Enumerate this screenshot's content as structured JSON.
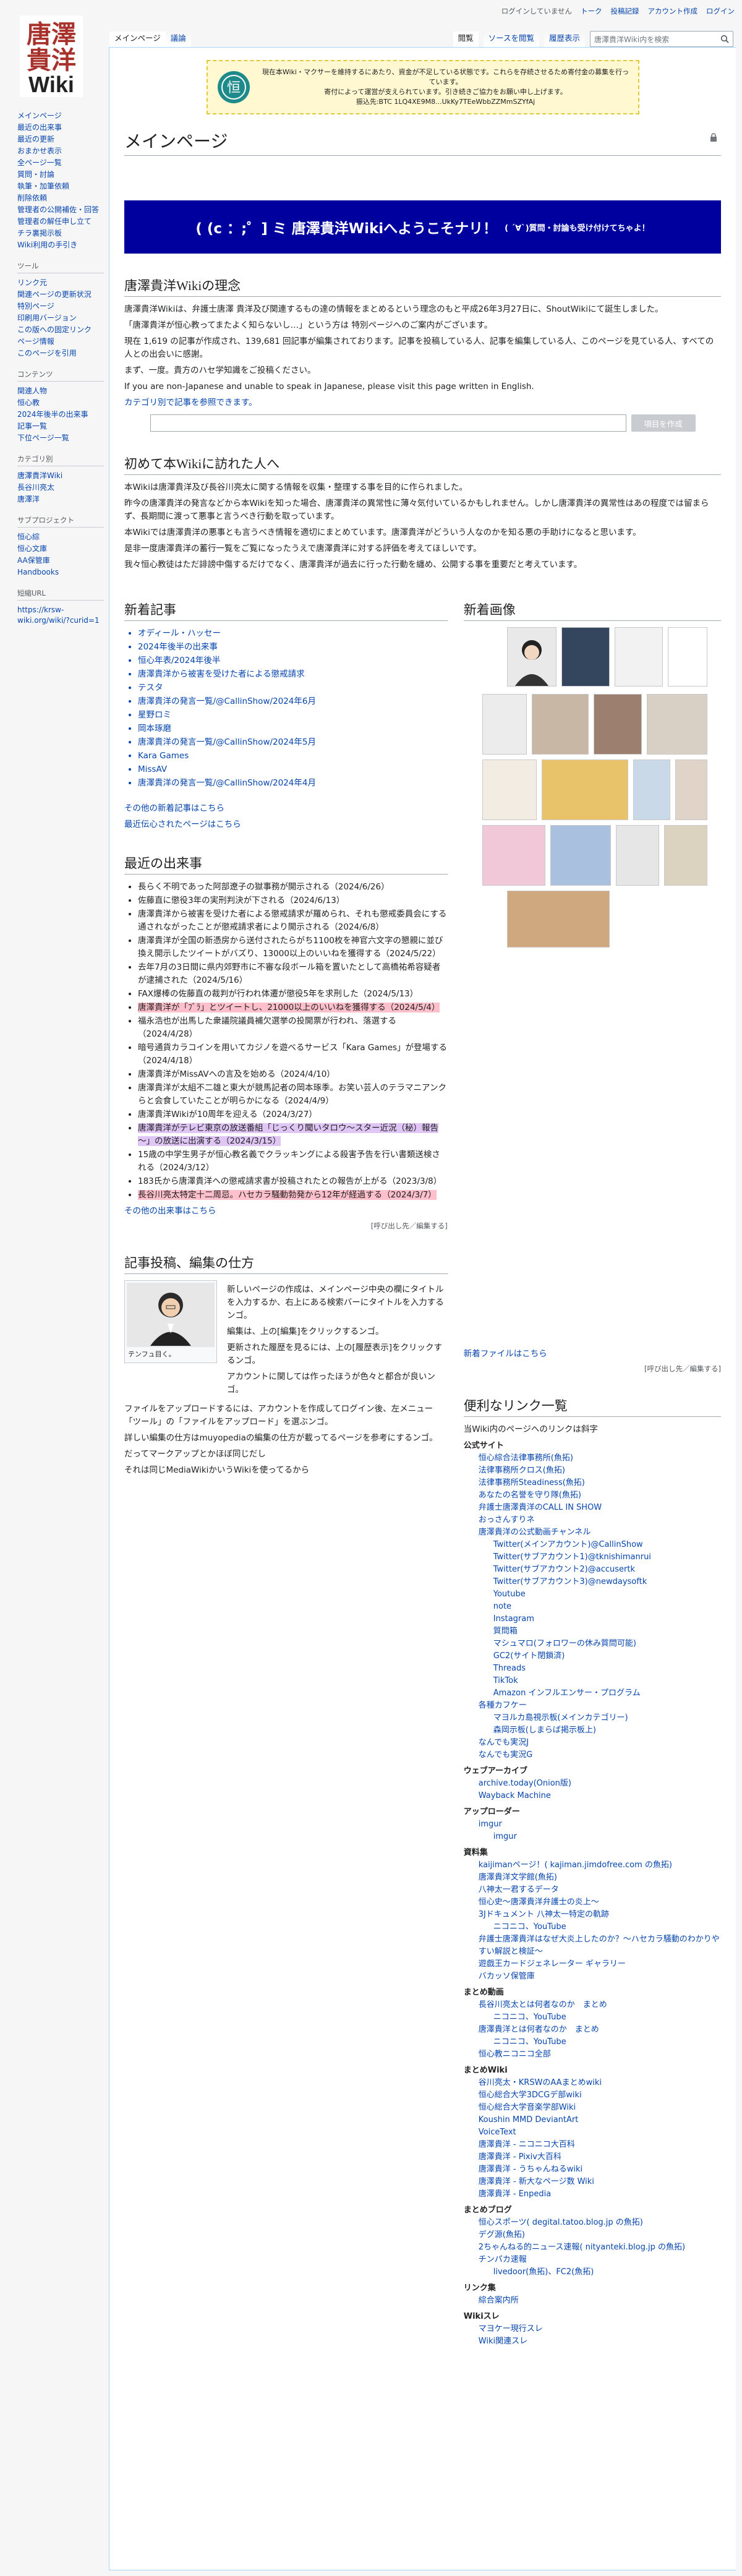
{
  "logo": {
    "line1": "唐澤",
    "line2": "貴洋",
    "line3": "Wiki"
  },
  "personal": [
    "ログインしていません",
    "トーク",
    "投稿記録",
    "アカウント作成",
    "ログイン"
  ],
  "tabs_left": [
    "メインページ",
    "議論"
  ],
  "tabs_right": [
    "閲覧",
    "ソースを閲覧",
    "履歴表示"
  ],
  "search": {
    "placeholder": "唐澤貴洋Wiki内を検索"
  },
  "sidebar": {
    "nav": [
      "メインページ",
      "最近の出来事",
      "最近の更新",
      "おまかせ表示",
      "全ページ一覧",
      "質問・討論",
      "執筆・加筆依頼",
      "削除依頼",
      "管理者の公開補佐・回答",
      "管理者の解任申し立て",
      "チラ裏掲示板",
      "Wiki利用の手引き"
    ],
    "tools_title": "ツール",
    "tools": [
      "リンク元",
      "関連ページの更新状況",
      "特別ページ",
      "印刷用バージョン",
      "この版への固定リンク",
      "ページ情報",
      "このページを引用"
    ],
    "content_title": "コンテンツ",
    "content": [
      "関連人物",
      "恒心教",
      "2024年後半の出来事",
      "記事一覧",
      "下位ページ一覧"
    ],
    "category_title": "カテゴリ別",
    "category": [
      "唐澤貴洋Wiki",
      "長谷川亮太",
      "唐澤洋"
    ],
    "sub_title": "サブプロジェクト",
    "sub": [
      "恒心綜",
      "恒心文庫",
      "AA保管庫",
      "Handbooks"
    ],
    "short_title": "短縮URL",
    "short": [
      "https://krsw-wiki.org/wiki/?curid=1"
    ]
  },
  "notice": {
    "line1": "現在本Wiki・マクサーを維持するにあたり、資金が不足している状態です。これらを存続させるため寄付金の募集を行っています。",
    "line2": "寄付によって運営が支えられています。引き続きご協力をお願い申し上げます。",
    "line3": "振込先:BTC 1LQ4XE9M8...UkKy7TEeWbbZZMmSZYfAj"
  },
  "page_title": "メインページ",
  "banner": {
    "big": "( (c ：;゜] ミ 唐澤貴洋Wikiへようこそナリ！",
    "small": "( ´∀`)質問・討論も受け付けてちゃよ！"
  },
  "rinen": {
    "h": "唐澤貴洋Wikiの理念",
    "p1": "唐澤貴洋Wikiは、弁護士唐澤 貴洋及び関連するもの達の情報をまとめるという理念のもと平成26年3月27日に、ShoutWikiにて誕生しました。",
    "p2": "「唐澤貴洋が恒心教ってまたよく知らないし…」という方は 特別ページへのご案内がございます。",
    "p3": "現在 1,619 の記事が作成され、139,681 回記事が編集されております。記事を投稿している人、記事を編集している人、このページを見ている人、すべての人との出会いに感謝。",
    "p4": "まず、一度。貴方のハセ学知識をご投稿ください。",
    "p5": "If you are non-Japanese and unable to speak in Japanese, please visit this page written in English.",
    "p6": "カテゴリ別で記事を参照できます。",
    "btn": "項目を作成"
  },
  "first": {
    "h": "初めて本Wikiに訪れた人へ",
    "p1": "本Wikiは唐澤貴洋及び長谷川亮太に関する情報を収集・整理する事を目的に作られました。",
    "p2": "昨今の唐澤貴洋の発言などから本Wikiを知った場合、唐澤貴洋の異常性に薄々気付いているかもしれません。しかし唐澤貴洋の異常性はあの程度では留まらず、長期間に渡って悪事と言うべき行動を取っています。",
    "p3": "本Wikiでは唐澤貴洋の悪事とも言うべき情報を適切にまとめています。唐澤貴洋がどういう人なのかを知る悪の手助けになると思います。",
    "p4": "是非一度唐澤貴洋の蓄行一覧をご覧になったうえで唐澤貴洋に対する評価を考えてほしいです。",
    "p5": "我々恒心教徒はただ誹謗中傷するだけでなく、唐澤貴洋が過去に行った行動を纏め、公開する事を重要だと考えています。"
  },
  "news": {
    "h": "新着記事",
    "items": [
      "オディール・ハッセー",
      "2024年後半の出来事",
      "恒心年表/2024年後半",
      "唐澤貴洋から被害を受けた者による懲戒請求",
      "テスタ",
      "唐澤貴洋の発言一覧/@CallinShow/2024年6月",
      "星野ロミ",
      "岡本琢磨",
      "唐澤貴洋の発言一覧/@CallinShow/2024年5月",
      "Kara Games",
      "MissAV",
      "唐澤貴洋の発言一覧/@CallinShow/2024年4月"
    ],
    "more1": "その他の新着記事はこちら",
    "more2": "最近伝心されたページはこちら"
  },
  "images": {
    "h": "新着画像",
    "more": "新着ファイルはこちら",
    "ctrl": "[呼び出し先／編集する]"
  },
  "events": {
    "h": "最近の出来事",
    "items": [
      {
        "t": "長らく不明であった阿部遼子の獄事務が開示される（2024/6/26）",
        "c": ""
      },
      {
        "t": "佐藤直に懲役3年の実刑判決が下される（2024/6/13）",
        "c": ""
      },
      {
        "t": "唐澤貴洋から被害を受けた者による懲戒請求が羅められ、それも懲戒委員会にする通されながったことが懲戒請求者により開示される（2024/6/8）",
        "c": ""
      },
      {
        "t": "唐澤貴洋が全国の新憑房から送付されたらがち1100枚を神官六文字の懇親に並び換え開示したツイートがバズり、13000以上のいいねを獲得する（2024/5/22）",
        "c": ""
      },
      {
        "t": "去年7月の3日間に県内郊野市に不審な段ボール箱を置いたとして高橋祐希容疑者が逮捕された（2024/5/16）",
        "c": ""
      },
      {
        "t": "FAX爆棒の佐藤直の裁判が行われ体遷が懲役5年を求刑した（2024/5/13）",
        "c": ""
      },
      {
        "t": "唐澤貴洋が「ﾌﾞﾗ」とツイートし、21000以上のいいねを獲得する（2024/5/4）",
        "c": "hl1"
      },
      {
        "t": "福永浩也が出馬した衆議院議員補欠選挙の投開票が行われ、落選する（2024/4/28）",
        "c": ""
      },
      {
        "t": "暗号通貨カラコインを用いてカジノを遊べるサービス「Kara Games」が登場する（2024/4/18）",
        "c": ""
      },
      {
        "t": "唐澤貴洋がMissAVへの言及を始める（2024/4/10）",
        "c": ""
      },
      {
        "t": "唐澤貴洋が太組不二雄と東大が競馬記者の岡本琢季。お笑い芸人のテラマニアンクらと会食していたことが明らかになる（2024/4/9）",
        "c": ""
      },
      {
        "t": "唐澤貴洋Wikiが10周年を迎える（2024/3/27）",
        "c": ""
      },
      {
        "t": "唐澤貴洋がテレビ東京の放送番組「じっくり聞いタロウ～スター近況（秘）報告～」の放送に出演する（2024/3/15）",
        "c": "hl2"
      },
      {
        "t": "15歳の中学生男子が恒心教名義でクラッキングによる殺害予告を行い書類送検される（2024/3/12）",
        "c": ""
      },
      {
        "t": "183氏から唐澤貴洋への懲戒請求書が投稿されたとの報告が上がる（2023/3/8）",
        "c": ""
      },
      {
        "t": "長谷川亮太特定十二周忌。ハセカラ騒動勃発から12年が経過する（2024/3/7）",
        "c": "hl1"
      }
    ],
    "more": "その他の出来事はこちら",
    "ctrl": "[呼び出し先／編集する]"
  },
  "howto": {
    "h": "記事投稿、編集の仕方",
    "caption": "テンフュ目く。",
    "p1": "新しいページの作成は、メインページ中央の欄にタイトルを入力するか、右上にある検索バーにタイトルを入力するンゴ。",
    "p2": "編集は、上の[編集]をクリックするンゴ。",
    "p3": "更新された履歴を見るには、上の[履歴表示]をクリックするンゴ。",
    "p4": "アカウントに関しては作ったほうが色々と都合が良いンゴ。",
    "p5": "ファイルをアップロードするには、アカウントを作成してログイン後、左メニュー「ツール」の「ファイルをアップロード」を選ぶンゴ。",
    "p6": "詳しい編集の仕方はmuyopediaの編集の仕方が載ってるページを参考にするンゴ。",
    "p7": "だってマークアップとかほぼ同じだし",
    "p8": "それは同じMediaWikiかいうWikiを使ってるから"
  },
  "links": {
    "h": "便利なリンク一覧",
    "intro": "当Wiki内のページへのリンクは斜字",
    "groups": [
      {
        "dt": "公式サイト",
        "dd": [
          [
            "恒心綜合法律事務所(魚拓)",
            1
          ],
          [
            "法律事務所クロス(魚拓)",
            1
          ],
          [
            "法律事務所Steadiness(魚拓)",
            1
          ],
          [
            "あなたの名誉を守り隊(魚拓)",
            1
          ],
          [
            "弁護士唐澤貴洋のCALL IN SHOW",
            1
          ],
          [
            "おっさんすりネ",
            1
          ],
          [
            "唐澤貴洋の公式動画チャンネル",
            1
          ],
          [
            "Twitter(メインアカウント)@CallinShow",
            2
          ],
          [
            "Twitter(サブアカウント1)@tknishimanrui",
            2
          ],
          [
            "Twitter(サブアカウント2)@accusertk",
            2
          ],
          [
            "Twitter(サブアカウント3)@newdaysoftk",
            2
          ],
          [
            "Youtube",
            2
          ],
          [
            "note",
            2
          ],
          [
            "Instagram",
            2
          ],
          [
            "質問箱",
            2
          ],
          [
            "マシュマロ(フォロワーの休み質問可能)",
            2
          ],
          [
            "GC2(サイト閉鎖済)",
            2
          ],
          [
            "Threads",
            2
          ],
          [
            "TikTok",
            2
          ],
          [
            "Amazon インフルエンサー・プログラム",
            2
          ],
          [
            "各種カフケー",
            1
          ],
          [
            "マヨルカ島視示板(メインカテゴリー)",
            2
          ],
          [
            "森岡示板(しまらば掲示板上)",
            2
          ],
          [
            "なんでも実況J",
            1
          ],
          [
            "なんでも実況G",
            1
          ]
        ]
      },
      {
        "dt": "ウェブアーカイブ",
        "dd": [
          [
            "archive.today(Onion版)",
            1
          ],
          [
            "Wayback Machine",
            1
          ]
        ]
      },
      {
        "dt": "アップローダー",
        "dd": [
          [
            "imgur",
            1
          ],
          [
            "imgur",
            2
          ]
        ]
      },
      {
        "dt": "資料集",
        "dd": [
          [
            "kaijimanページ！( kajiman.jimdofree.com の魚拓)",
            1
          ],
          [
            "唐澤貴洋文学館(魚拓)",
            1
          ],
          [
            "八神太一君するデータ",
            1
          ],
          [
            "恒心史～唐澤貴洋弁護士の炎上～",
            1
          ],
          [
            "3Jドキュメント 八神太一特定の軌跡",
            1
          ],
          [
            "ニコニコ、YouTube",
            2
          ],
          [
            "弁護士唐澤貴洋はなぜ大炎上したのか？～ハセカラ騒動のわかりやすい解説と検証～",
            1
          ],
          [
            "遊戯王カードジェネレーター ギャラリー",
            1
          ],
          [
            "バカッソ保管庫",
            1
          ]
        ]
      },
      {
        "dt": "まとめ動画",
        "dd": [
          [
            "長谷川亮太とは何者なのか　まとめ",
            1
          ],
          [
            "ニコニコ、YouTube",
            2
          ],
          [
            "唐澤貴洋とは何者なのか　まとめ",
            1
          ],
          [
            "ニコニコ、YouTube",
            2
          ],
          [
            "恒心教ニコニコ全部",
            1
          ]
        ]
      },
      {
        "dt": "まとめWiki",
        "dd": [
          [
            "谷川亮太・KRSWのAAまとめwiki",
            1
          ],
          [
            "恒心総合大学3DCGデ部wiki",
            1
          ],
          [
            "恒心総合大学音楽学部Wiki",
            1
          ],
          [
            "Koushin MMD DeviantArt",
            1
          ],
          [
            "VoiceText",
            1
          ],
          [
            "唐澤貴洋 - ニコニコ大百科",
            1
          ],
          [
            "唐澤貴洋 - Pixiv大百科",
            1
          ],
          [
            "唐澤貴洋 - うちゃんねるwiki",
            1
          ],
          [
            "唐澤貴洋 - 新大なページ数 Wiki",
            1
          ],
          [
            "唐澤貴洋 - Enpedia",
            1
          ]
        ]
      },
      {
        "dt": "まとめブログ",
        "dd": [
          [
            "恒心スポーツ( degital.tatoo.blog.jp の魚拓)",
            1
          ],
          [
            "デグ源(魚拓)",
            1
          ],
          [
            "2ちゃんねる的ニュース速報( nityanteki.blog.jp の魚拓)",
            1
          ],
          [
            "チンパカ速報",
            1
          ],
          [
            "livedoor(魚拓)、FC2(魚拓)",
            2
          ]
        ]
      },
      {
        "dt": "リンク集",
        "dd": [
          [
            "綜合案内所",
            1
          ]
        ]
      },
      {
        "dt": "Wikiスレ",
        "dd": [
          [
            "マヨケー現行スレ",
            1
          ],
          [
            "Wiki関連スレ",
            1
          ]
        ]
      }
    ]
  },
  "colors": {
    "accent": "#0645ad",
    "banner": "#00009f",
    "notice_bg": "#fff8d0",
    "highlight_pink": "#ffc0cb",
    "highlight_purple": "#e0c6f5"
  }
}
